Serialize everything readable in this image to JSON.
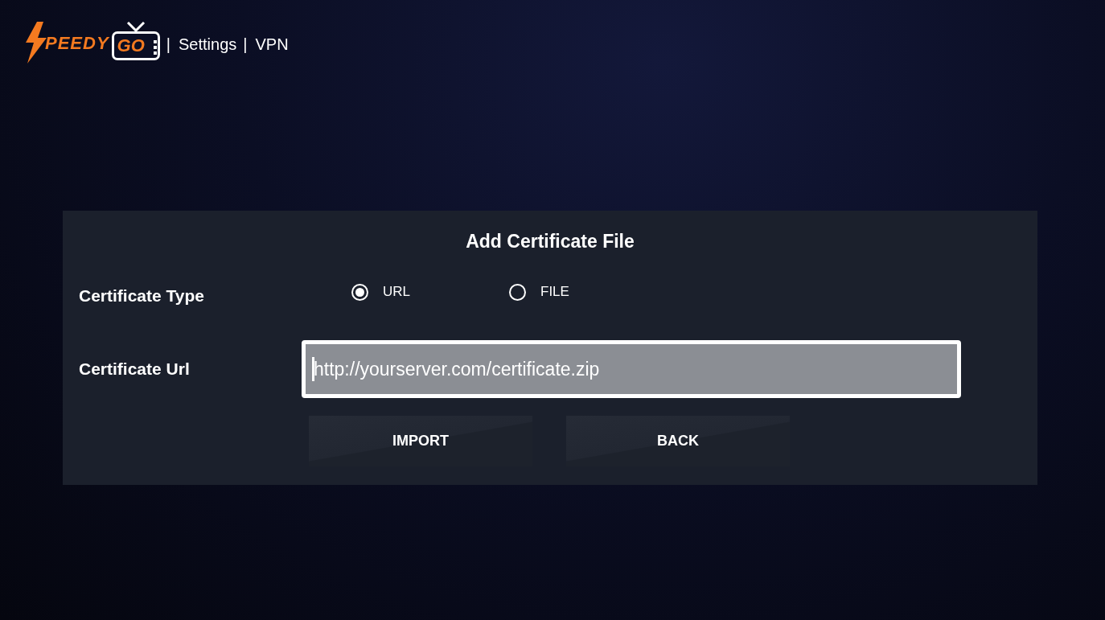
{
  "header": {
    "logo": {
      "text_1": "PEEDY",
      "text_2": "GO"
    },
    "breadcrumb": [
      {
        "separator": "|",
        "label": "Settings"
      },
      {
        "separator": "|",
        "label": "VPN"
      }
    ]
  },
  "dialog": {
    "title": "Add Certificate File",
    "certificate_type": {
      "label": "Certificate Type",
      "options": [
        {
          "label": "URL",
          "selected": true
        },
        {
          "label": "FILE",
          "selected": false
        }
      ]
    },
    "certificate_url": {
      "label": "Certificate Url",
      "value": "http://yourserver.com/certificate.zip"
    },
    "buttons": [
      {
        "label": "IMPORT"
      },
      {
        "label": "BACK"
      }
    ]
  }
}
